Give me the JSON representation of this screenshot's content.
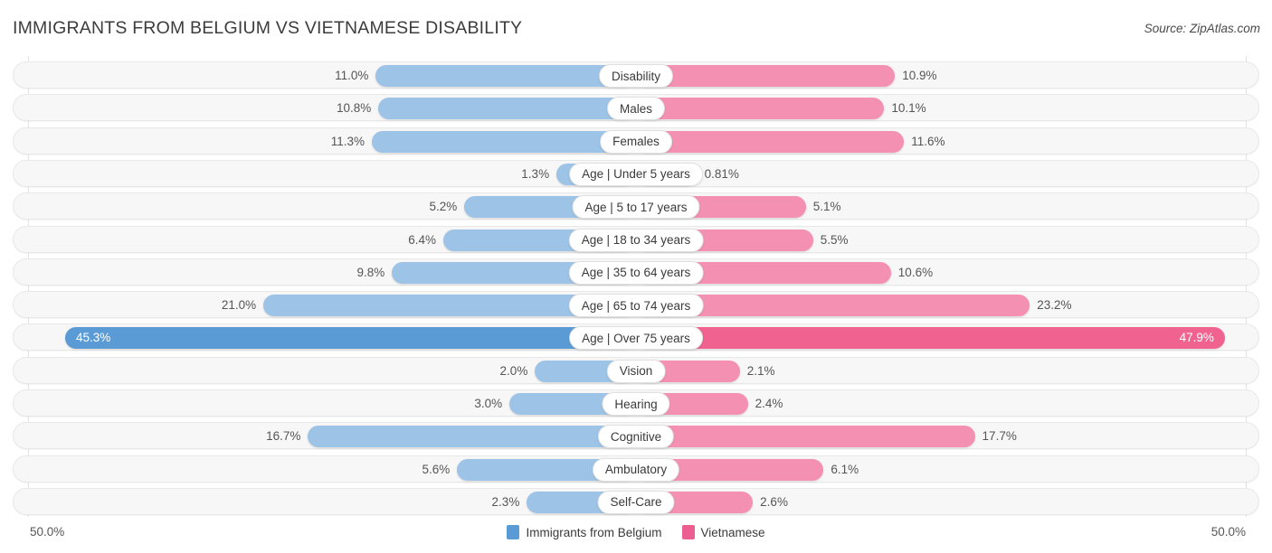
{
  "header": {
    "title": "IMMIGRANTS FROM BELGIUM VS VIETNAMESE DISABILITY",
    "source": "Source: ZipAtlas.com"
  },
  "axis": {
    "left_end_label": "50.0%",
    "right_end_label": "50.0%",
    "max": 50
  },
  "legend": {
    "items": [
      {
        "label": "Immigrants from Belgium",
        "color": "#5b9bd5",
        "name": "legend-swatch-belgium"
      },
      {
        "label": "Vietnamese",
        "color": "#ec5e8f",
        "name": "legend-swatch-vietnamese"
      }
    ]
  },
  "colors": {
    "left_bar": "#9dc3e6",
    "right_bar": "#f490b1",
    "left_bar_highlight": "#5b9bd5",
    "right_bar_highlight": "#f0628f",
    "track": "#f7f7f7",
    "gridline": "#e3e3e3"
  },
  "chart_data": {
    "type": "bar",
    "orientation": "horizontal-diverging",
    "title": "IMMIGRANTS FROM BELGIUM VS VIETNAMESE DISABILITY",
    "xlabel": "",
    "ylabel": "",
    "xlim": [
      50,
      50
    ],
    "grid": true,
    "legend_position": "bottom-center",
    "categories": [
      "Disability",
      "Males",
      "Females",
      "Age | Under 5 years",
      "Age | 5 to 17 years",
      "Age | 18 to 34 years",
      "Age | 35 to 64 years",
      "Age | 65 to 74 years",
      "Age | Over 75 years",
      "Vision",
      "Hearing",
      "Cognitive",
      "Ambulatory",
      "Self-Care"
    ],
    "series": [
      {
        "name": "Immigrants from Belgium",
        "color": "#5b9bd5",
        "values": [
          11.0,
          10.8,
          11.3,
          1.3,
          5.2,
          6.4,
          9.8,
          21.0,
          45.3,
          2.0,
          3.0,
          16.7,
          5.6,
          2.3
        ],
        "labels": [
          "11.0%",
          "10.8%",
          "11.3%",
          "1.3%",
          "5.2%",
          "6.4%",
          "9.8%",
          "21.0%",
          "45.3%",
          "2.0%",
          "3.0%",
          "16.7%",
          "5.6%",
          "2.3%"
        ]
      },
      {
        "name": "Vietnamese",
        "color": "#ec5e8f",
        "values": [
          10.9,
          10.1,
          11.6,
          0.81,
          5.1,
          5.5,
          10.6,
          23.2,
          47.9,
          2.1,
          2.4,
          17.7,
          6.1,
          2.6
        ],
        "labels": [
          "10.9%",
          "10.1%",
          "11.6%",
          "0.81%",
          "5.1%",
          "5.5%",
          "10.6%",
          "23.2%",
          "47.9%",
          "2.1%",
          "2.4%",
          "17.7%",
          "6.1%",
          "2.6%"
        ]
      }
    ],
    "highlight_rows": [
      8
    ]
  }
}
